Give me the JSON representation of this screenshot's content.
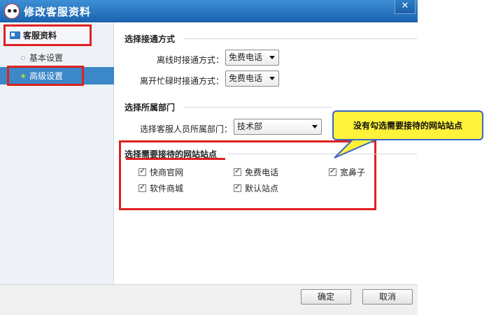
{
  "window": {
    "title": "修改客服资料",
    "close_glyph": "✕"
  },
  "sidebar": {
    "header": "客服资料",
    "items": [
      {
        "label": "基本设置",
        "selected": false
      },
      {
        "label": "高级设置",
        "selected": true
      }
    ]
  },
  "connect": {
    "title": "选择接通方式",
    "offline_label": "离线时接通方式：",
    "offline_value": "免费电话",
    "busy_label": "离开忙碌时接通方式：",
    "busy_value": "免费电话"
  },
  "department": {
    "title": "选择所属部门",
    "label": "选择客服人员所属部门：",
    "value": "技术部"
  },
  "sites": {
    "title": "选择需要接待的网站站点",
    "items": [
      {
        "label": "快商官网",
        "checked": true
      },
      {
        "label": "免费电话",
        "checked": true
      },
      {
        "label": "宽鼻子",
        "checked": true
      },
      {
        "label": "软件商城",
        "checked": true
      },
      {
        "label": "默认站点",
        "checked": true
      }
    ]
  },
  "callout": {
    "text": "没有勾选需要接待的网站站点"
  },
  "footer": {
    "ok_label": "确定",
    "cancel_label": "取消"
  },
  "colors": {
    "title_bar": "#1b64b0",
    "highlight_red": "#e02020",
    "callout_yellow": "#fff23a",
    "selected_item": "#3c87c8"
  }
}
